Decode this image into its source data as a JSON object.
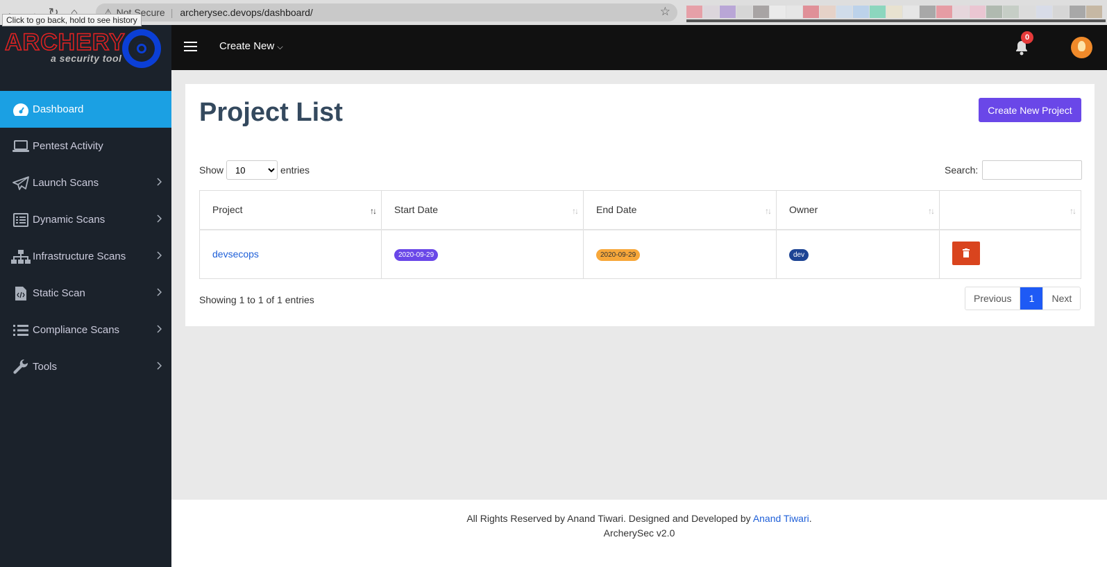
{
  "browser": {
    "security_label": "Not Secure",
    "url": "archerysec.devops/dashboard/",
    "tooltip": "Click to go back, hold to see history",
    "bookmark_colors": [
      "#e6a0a8",
      "#dcd6dc",
      "#b9a6d6",
      "#d6d6d6",
      "#a8a4a4",
      "#eaeaea",
      "#e6e6e6",
      "#e09098",
      "#e6d2c8",
      "#d0dcea",
      "#bcd2ea",
      "#8cd6be",
      "#e8e2d0",
      "#e6e6e6",
      "#a8a8a8",
      "#e69ca4",
      "#e6d6dc",
      "#eac6d2",
      "#b0bab0",
      "#c6cec6",
      "#dcdcdc",
      "#d8dce8",
      "#d6d6d6",
      "#a8a8a8",
      "#c6b8a4"
    ]
  },
  "logo": {
    "title": "ARCHERY",
    "subtitle": "a security tool"
  },
  "sidebar": {
    "items": [
      {
        "label": "Dashboard",
        "icon": "dashboard-gauge-icon",
        "active": true,
        "has_children": false
      },
      {
        "label": "Pentest Activity",
        "icon": "laptop-icon",
        "active": false,
        "has_children": false
      },
      {
        "label": "Launch Scans",
        "icon": "paper-plane-icon",
        "active": false,
        "has_children": true
      },
      {
        "label": "Dynamic Scans",
        "icon": "list-alt-icon",
        "active": false,
        "has_children": true
      },
      {
        "label": "Infrastructure Scans",
        "icon": "sitemap-icon",
        "active": false,
        "has_children": true
      },
      {
        "label": "Static Scan",
        "icon": "file-code-icon",
        "active": false,
        "has_children": true
      },
      {
        "label": "Compliance Scans",
        "icon": "list-icon",
        "active": false,
        "has_children": true
      },
      {
        "label": "Tools",
        "icon": "wrench-icon",
        "active": false,
        "has_children": true
      }
    ]
  },
  "topbar": {
    "create_new_label": "Create New",
    "notification_count": "0"
  },
  "main": {
    "page_title": "Project List",
    "create_project_label": "Create New Project",
    "show_label": "Show",
    "entries_label": "entries",
    "page_size_options": [
      "10"
    ],
    "page_size_selected": "10",
    "search_label": "Search:",
    "search_value": "",
    "columns": [
      "Project",
      "Start Date",
      "End Date",
      "Owner",
      ""
    ],
    "rows": [
      {
        "project": "devsecops",
        "start_date": "2020-09-29",
        "end_date": "2020-09-29",
        "owner": "dev"
      }
    ],
    "info_text": "Showing 1 to 1 of 1 entries",
    "pagination": {
      "previous": "Previous",
      "current": "1",
      "next": "Next"
    }
  },
  "footer": {
    "line1_prefix": "All Rights Reserved by Anand Tiwari. Designed and Developed by ",
    "line1_link": "Anand Tiwari",
    "line1_suffix": ".",
    "line2": "ArcherySec v2.0"
  },
  "colors": {
    "sidebar_bg": "#1b222b",
    "active_item": "#1ba0e3",
    "primary_purple": "#6a47e8",
    "delete_red": "#d9441e",
    "pager_active": "#1e5af5"
  }
}
